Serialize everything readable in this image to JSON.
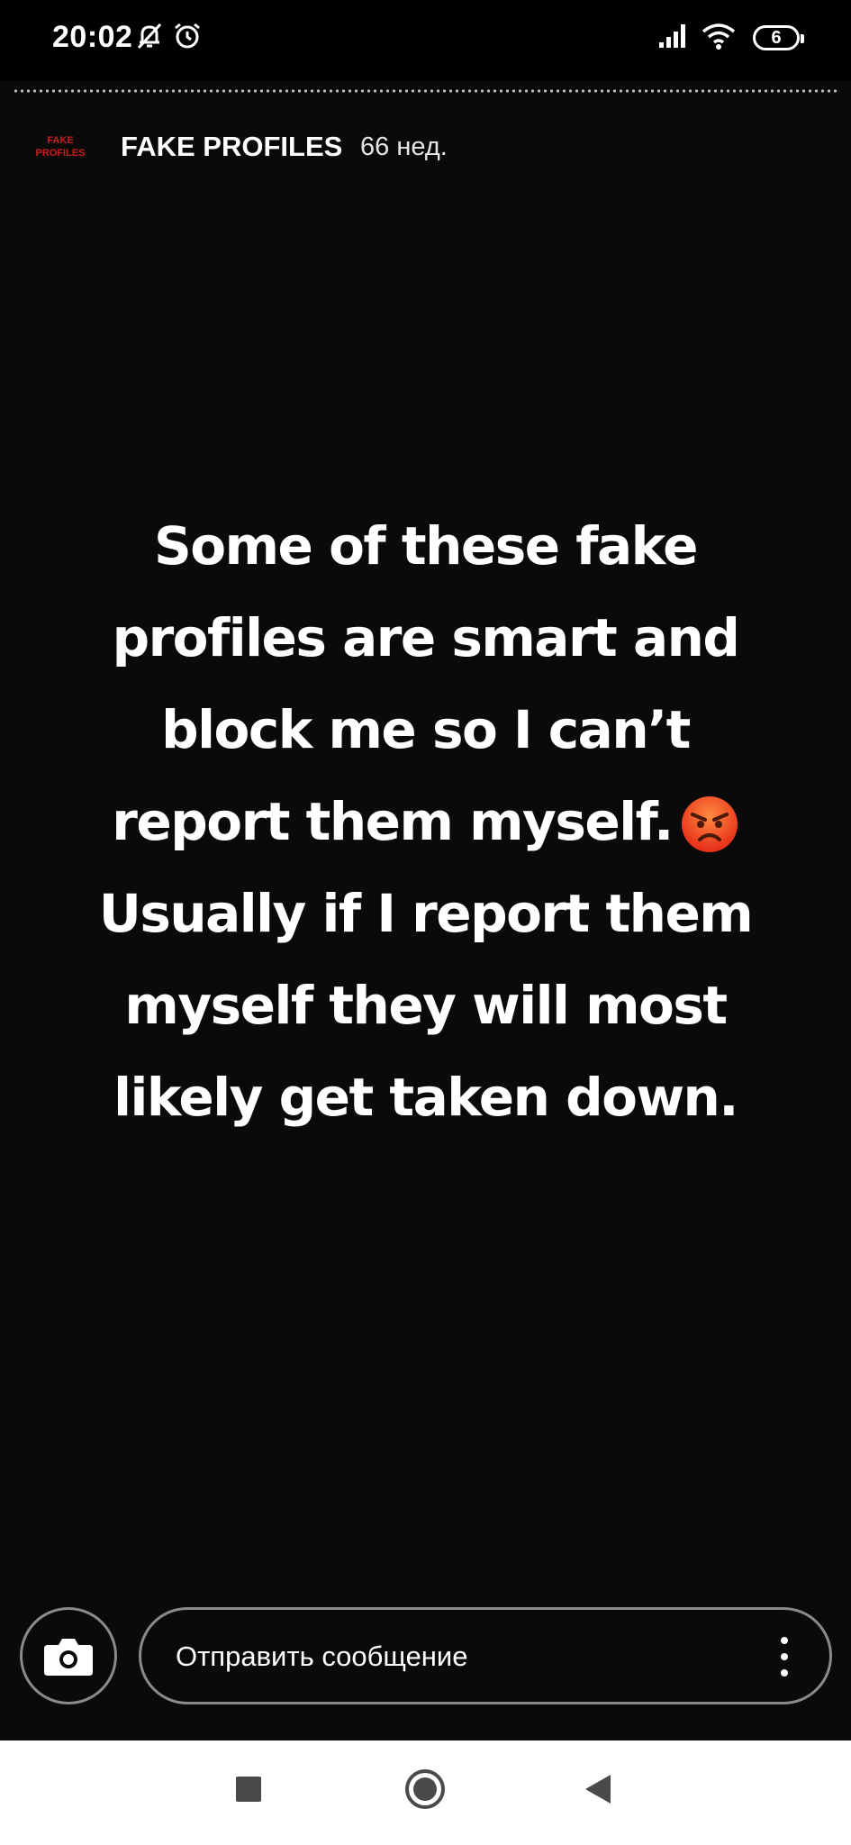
{
  "status_bar": {
    "time": "20:02",
    "icons": [
      "mute-notification-icon",
      "alarm-icon",
      "signal-icon",
      "wifi-icon"
    ],
    "battery_level": "6"
  },
  "story": {
    "progress": 1.0,
    "account": {
      "avatar_lines": [
        "FAKE",
        "PROFILES"
      ],
      "name": "FAKE PROFILES",
      "age": "66 нед."
    },
    "text_lines": [
      "Some of these fake",
      "profiles are smart and",
      "block me so I can’t",
      "report them myself.",
      "Usually if I report them",
      "myself they will most",
      "likely get taken down."
    ],
    "emoji": "angry-face-emoji"
  },
  "reply_bar": {
    "placeholder": "Отправить сообщение",
    "camera_icon": "camera-icon",
    "more_icon": "more-vertical-icon"
  },
  "nav_bar": {
    "buttons": [
      "recents-button",
      "home-button",
      "back-button"
    ]
  },
  "colors": {
    "background": "#0a0a0a",
    "text": "#ffffff",
    "avatar_red": "#c81e1e",
    "nav_bar": "#ffffff",
    "nav_icons": "#4a4a4a"
  }
}
